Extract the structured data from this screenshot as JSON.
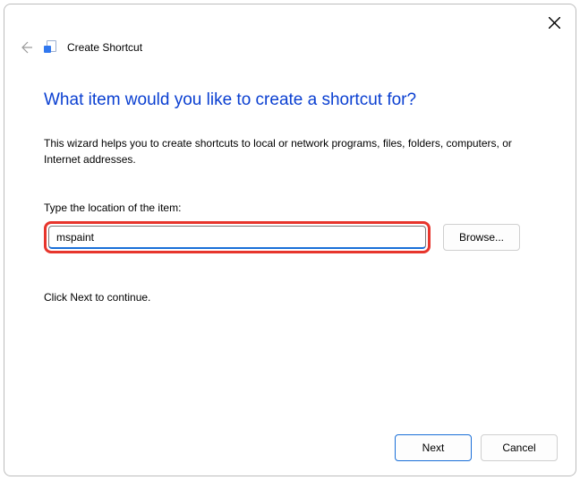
{
  "header": {
    "title": "Create Shortcut"
  },
  "main": {
    "heading": "What item would you like to create a shortcut for?",
    "description": "This wizard helps you to create shortcuts to local or network programs, files, folders, computers, or Internet addresses.",
    "field_label": "Type the location of the item:",
    "location_value": "mspaint",
    "browse_label": "Browse...",
    "continue_text": "Click Next to continue."
  },
  "footer": {
    "next_label": "Next",
    "cancel_label": "Cancel"
  }
}
